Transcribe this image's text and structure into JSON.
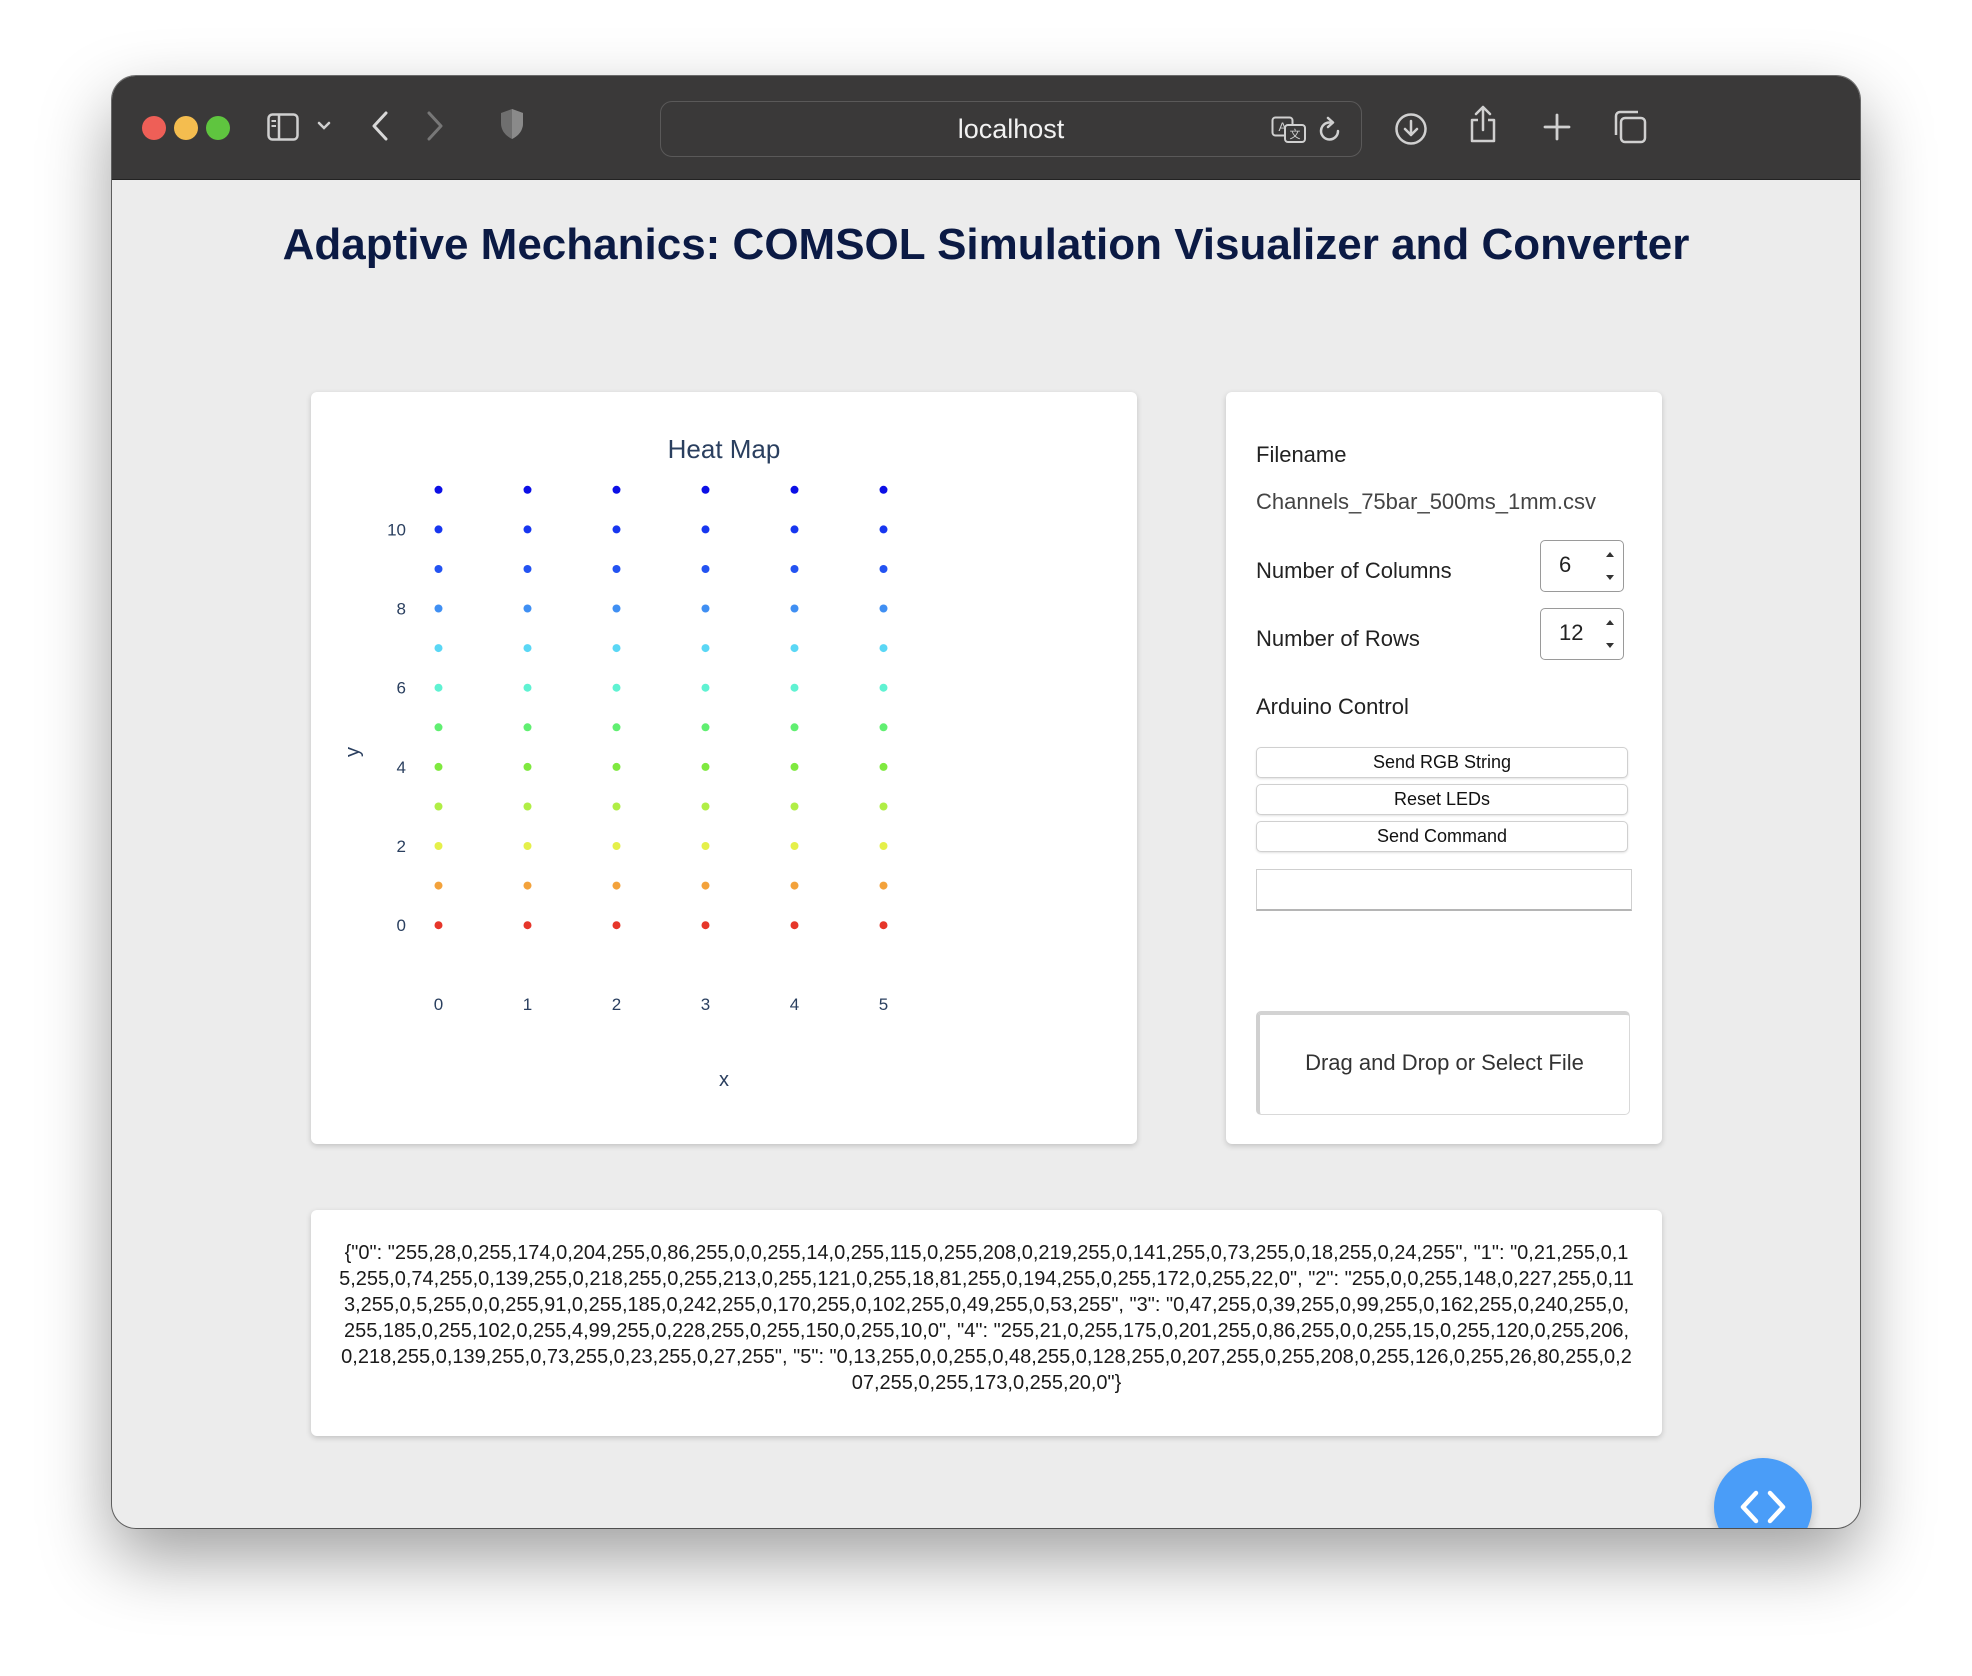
{
  "browser": {
    "url": "localhost",
    "icons": [
      "sidebar-icon",
      "chevron-down-icon",
      "back-icon",
      "forward-icon",
      "shield-icon",
      "translate-icon",
      "reload-icon",
      "download-icon",
      "share-icon",
      "new-tab-icon",
      "tabs-overview-icon"
    ],
    "traffic_lights": {
      "close": "#ee5f57",
      "minimize": "#f4bd4f",
      "zoom": "#5fc53f"
    }
  },
  "page": {
    "title": "Adaptive Mechanics: COMSOL Simulation Visualizer and Converter",
    "title_color": "#0b1a44"
  },
  "controls": {
    "filename_label": "Filename",
    "filename_value": "Channels_75bar_500ms_1mm.csv",
    "columns_label": "Number of Columns",
    "columns_value": "6",
    "rows_label": "Number of Rows",
    "rows_value": "12",
    "arduino_label": "Arduino Control",
    "send_rgb_label": "Send RGB String",
    "reset_leds_label": "Reset LEDs",
    "send_command_label": "Send Command",
    "command_value": "",
    "dropzone_label": "Drag and Drop or Select File"
  },
  "output": {
    "text": "{\"0\": \"255,28,0,255,174,0,204,255,0,86,255,0,0,255,14,0,255,115,0,255,208,0,219,255,0,141,255,0,73,255,0,18,255,0,24,255\", \"1\": \"0,21,255,0,15,255,0,74,255,0,139,255,0,218,255,0,255,213,0,255,121,0,255,18,81,255,0,194,255,0,255,172,0,255,22,0\", \"2\": \"255,0,0,255,148,0,227,255,0,113,255,0,5,255,0,0,255,91,0,255,185,0,242,255,0,170,255,0,102,255,0,49,255,0,53,255\", \"3\": \"0,47,255,0,39,255,0,99,255,0,162,255,0,240,255,0,255,185,0,255,102,0,255,4,99,255,0,228,255,0,255,150,0,255,10,0\", \"4\": \"255,21,0,255,175,0,201,255,0,86,255,0,0,255,15,0,255,120,0,255,206,0,218,255,0,139,255,0,73,255,0,23,255,0,27,255\", \"5\": \"0,13,255,0,0,255,0,48,255,0,128,255,0,207,255,0,255,208,0,255,126,0,255,26,80,255,0,207,255,0,255,173,0,255,20,0\"}"
  },
  "chart_data": {
    "type": "scatter",
    "title": "Heat Map",
    "xlabel": "x",
    "ylabel": "y",
    "x": [
      0,
      1,
      2,
      3,
      4,
      5
    ],
    "y": [
      0,
      1,
      2,
      3,
      4,
      5,
      6,
      7,
      8,
      9,
      10,
      11
    ],
    "x_ticks": [
      "0",
      "1",
      "2",
      "3",
      "4",
      "5"
    ],
    "y_ticks": [
      "0",
      "2",
      "4",
      "6",
      "8",
      "10"
    ],
    "xlim": [
      -0.5,
      5.5
    ],
    "ylim": [
      -0.5,
      11.5
    ],
    "grid": false,
    "row_colors": [
      "#e6362a",
      "#f3a23b",
      "#e5f04a",
      "#b0ee45",
      "#7fe93f",
      "#60ef71",
      "#5ff2d2",
      "#5ad7f5",
      "#3f8ff3",
      "#2353f2",
      "#1736f0",
      "#0c0fe6"
    ]
  },
  "fab": {
    "icon": "code-icon",
    "color": "#4a9df8"
  }
}
